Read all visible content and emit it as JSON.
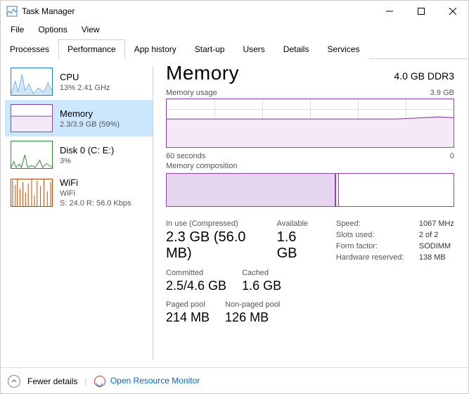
{
  "window": {
    "title": "Task Manager"
  },
  "menu": {
    "file": "File",
    "options": "Options",
    "view": "View"
  },
  "tabs": [
    "Processes",
    "Performance",
    "App history",
    "Start-up",
    "Users",
    "Details",
    "Services"
  ],
  "active_tab": 1,
  "sidebar": {
    "items": [
      {
        "label": "CPU",
        "sub": "13% 2.41 GHz",
        "color": "#1e7fd6"
      },
      {
        "label": "Memory",
        "sub": "2.3/3.9 GB (59%)",
        "color": "#8e44ad"
      },
      {
        "label": "Disk 0 (C: E:)",
        "sub": "3%",
        "color": "#2e8b33"
      },
      {
        "label": "WiFi",
        "sub": "WiFi",
        "sub2": "S: 24.0 R: 56.0 Kbps",
        "color": "#b54b0a"
      }
    ]
  },
  "main_title": "Memory",
  "main_summary": "4.0 GB DDR3",
  "usage": {
    "label": "Memory usage",
    "max": "3.9 GB",
    "xleft": "60 seconds",
    "xright": "0"
  },
  "composition": {
    "label": "Memory composition"
  },
  "stats": {
    "inuse_label": "In use (Compressed)",
    "inuse": "2.3 GB (56.0 MB)",
    "available_label": "Available",
    "available": "1.6 GB",
    "committed_label": "Committed",
    "committed": "2.5/4.6 GB",
    "cached_label": "Cached",
    "cached": "1.6 GB",
    "paged_label": "Paged pool",
    "paged": "214 MB",
    "nonpaged_label": "Non-paged pool",
    "nonpaged": "126 MB"
  },
  "info": {
    "speed_k": "Speed:",
    "speed_v": "1067 MHz",
    "slots_k": "Slots used:",
    "slots_v": "2 of 2",
    "form_k": "Form factor:",
    "form_v": "SODIMM",
    "hwres_k": "Hardware reserved:",
    "hwres_v": "138 MB"
  },
  "footer": {
    "fewer": "Fewer details",
    "rm": "Open Resource Monitor"
  },
  "chart_data": {
    "type": "line",
    "title": "Memory usage",
    "xlabel": "seconds ago",
    "ylabel": "GB",
    "ylim": [
      0,
      3.9
    ],
    "x": [
      60,
      55,
      50,
      45,
      40,
      35,
      30,
      25,
      20,
      15,
      10,
      5,
      0
    ],
    "values": [
      2.3,
      2.3,
      2.3,
      2.3,
      2.3,
      2.3,
      2.3,
      2.3,
      2.3,
      2.31,
      2.32,
      2.35,
      2.34
    ],
    "composition": {
      "in_use_gb": 2.3,
      "modified_gb": 0.06,
      "standby_gb": 1.6,
      "free_gb": 0.0,
      "total_gb": 3.9
    }
  }
}
